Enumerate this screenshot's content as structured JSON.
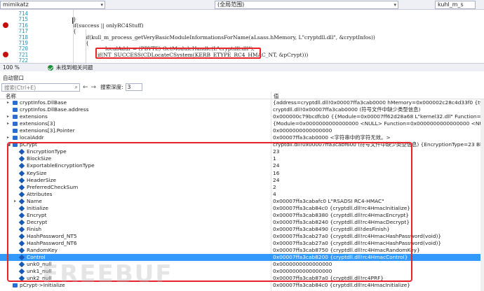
{
  "topbar": {
    "project": "mimikatz",
    "scope": "(全局范围)",
    "member": "kuhl_m_s"
  },
  "editor": {
    "lines": [
      {
        "num": "714",
        "bp": false,
        "text": ""
      },
      {
        "num": "715",
        "bp": false,
        "text": "}"
      },
      {
        "num": "716",
        "bp": true,
        "text": "if(success || onlyRC4Stuff)"
      },
      {
        "num": "717",
        "bp": false,
        "text": "{"
      },
      {
        "num": "718",
        "bp": false,
        "text": "if(kull_m_process_getVeryBasicModuleInformationsForName(aLsass.hMemory, L\"cryptdll.dll\", &cryptInfos))"
      },
      {
        "num": "719",
        "bp": false,
        "text": "{"
      },
      {
        "num": "720",
        "bp": false,
        "text": "localAddr = (PBYTE) GetModuleHandle(L\"cryptdll.dll\");"
      },
      {
        "num": "721",
        "bp": true,
        "text": "if(NT_SUCCESS(CDLocateCSystem(KERB_ETYPE_RC4_HMAC_NT, &pCrypt)))"
      },
      {
        "num": "722",
        "bp": false,
        "text": ""
      }
    ]
  },
  "status": {
    "zoom": "100 %",
    "message": "未找到相关问题"
  },
  "autos": {
    "title": "自动窗口",
    "search_placeholder": "搜索(Ctrl+E)",
    "depth_label": "搜索深度:",
    "depth_value": "3",
    "col_name": "名称",
    "col_value": "值"
  },
  "rows": [
    {
      "name": "cryptInfos.DllBase",
      "value": "{address=cryptdll.dll!0x00007ffa3cab0000 hMemory=0x000002c28c4d33f0 {type=KULL_M_MEMO",
      "level": 0,
      "exp": true
    },
    {
      "name": "cryptInfos.DllBase.address",
      "value": "cryptdll.dll!0x00007ffa3cab0000 (符号文件中缺少类型信息)",
      "level": 0,
      "exp": false
    },
    {
      "name": "extensions",
      "value": "0x000000c79bcdfcb0 {{Module=0x00007ff62d28a68 L\"kernel32.dll\" Function=0x00007ff62d28B",
      "level": 0,
      "exp": true
    },
    {
      "name": "extensions[3]",
      "value": "{Module=0x0000000000000000 <NULL> Function=0x0000000000000000 <NULL> ToReplace=0x000",
      "level": 0,
      "exp": true
    },
    {
      "name": "extensions[3].Pointer",
      "value": "0x0000000000000000",
      "level": 0,
      "exp": false
    },
    {
      "name": "localAddr",
      "value": "0x00007ffa3cab0000 <字符串中的字符无效。>",
      "level": 0,
      "exp": true
    },
    {
      "name": "pCrypt",
      "value": "cryptdll.dll!0x00007ffa3cabf600 (符号文件中缺少类型信息) {EncryptionType=23 BlockSize=1 Exp",
      "level": 0,
      "exp": "open"
    },
    {
      "name": "EncryptionType",
      "value": "23",
      "level": 1,
      "exp": false
    },
    {
      "name": "BlockSize",
      "value": "1",
      "level": 1,
      "exp": false
    },
    {
      "name": "ExportableEncryptionType",
      "value": "24",
      "level": 1,
      "exp": false
    },
    {
      "name": "KeySize",
      "value": "16",
      "level": 1,
      "exp": false
    },
    {
      "name": "HeaderSize",
      "value": "24",
      "level": 1,
      "exp": false
    },
    {
      "name": "PreferredCheckSum",
      "value": "2",
      "level": 1,
      "exp": false
    },
    {
      "name": "Attributes",
      "value": "4",
      "level": 1,
      "exp": false
    },
    {
      "name": "Name",
      "value": "0x00007ffa3cabafc0 L\"RSADSI RC4-HMAC\"",
      "level": 1,
      "exp": true
    },
    {
      "name": "Initialize",
      "value": "0x00007ffa3cab84c0 {cryptdll.dll!rc4HmacInitialize}",
      "level": 1,
      "exp": false
    },
    {
      "name": "Encrypt",
      "value": "0x00007ffa3cab8380 {cryptdll.dll!rc4HmacEncrypt}",
      "level": 1,
      "exp": false
    },
    {
      "name": "Decrypt",
      "value": "0x00007ffa3cab8240 {cryptdll.dll!rc4HmacDecrypt}",
      "level": 1,
      "exp": false
    },
    {
      "name": "Finish",
      "value": "0x00007ffa3cab8490 {cryptdll.dll!desFinish}",
      "level": 1,
      "exp": false
    },
    {
      "name": "HashPassword_NT5",
      "value": "0x00007ffa3cab27a0 {cryptdll.dll!rc4HmacHashPassword(void)}",
      "level": 1,
      "exp": false
    },
    {
      "name": "HashPassword_NT6",
      "value": "0x00007ffa3cab27a0 {cryptdll.dll!rc4HmacHashPassword(void)}",
      "level": 1,
      "exp": false
    },
    {
      "name": "RandomKey",
      "value": "0x00007ffa3cab8750 {cryptdll.dll!rc4HmacRandomKey}",
      "level": 1,
      "exp": false
    },
    {
      "name": "Control",
      "value": "0x00007ffa3cab8200 {cryptdll.dll!rc4HmacControl}",
      "level": 1,
      "exp": false,
      "selected": true
    },
    {
      "name": "unk0_null",
      "value": "0x0000000000000000",
      "level": 1,
      "exp": false
    },
    {
      "name": "unk1_null",
      "value": "0x0000000000000000",
      "level": 1,
      "exp": false
    },
    {
      "name": "unk2_null",
      "value": "0x00007ffa3cab87a0 {cryptdll.dll!rc4PRF}",
      "level": 1,
      "exp": false
    },
    {
      "name": "pCrypt->Initialize",
      "value": "0x00007ffa3cab84c0 {cryptdll.dll!rc4HmacInitialize}",
      "level": 0,
      "exp": false
    }
  ],
  "colors": {
    "accent": "#3399ff",
    "highlight_border": "#e8242b",
    "breakpoint": "#c50f0f",
    "keyword": "#0000ff"
  }
}
